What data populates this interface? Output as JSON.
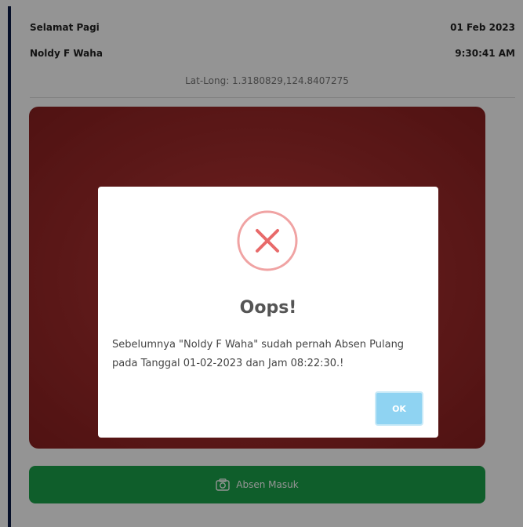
{
  "header": {
    "greeting": "Selamat Pagi",
    "user_name": "Noldy F Waha",
    "date": "01 Feb 2023",
    "time": "9:30:41 AM",
    "lat_long": "Lat-Long: 1.3180829,124.8407275"
  },
  "actions": {
    "absen_masuk_label": "Absen Masuk"
  },
  "modal": {
    "title": "Oops!",
    "message": "Sebelumnya \"Noldy F Waha\" sudah pernah Absen Pulang pada Tanggal 01-02-2023 dan Jam 08:22:30.!",
    "ok_label": "OK",
    "icon": "error-x-icon"
  },
  "colors": {
    "accent_dark": "#0b1a45",
    "error_red": "#e86a6a",
    "ok_button": "#8fd3f2",
    "primary_green": "#1aa24a",
    "camera_red": "#a02b2b"
  }
}
